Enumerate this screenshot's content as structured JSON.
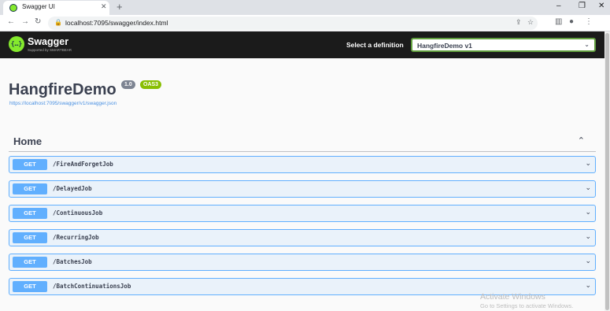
{
  "browser": {
    "tab_title": "Swagger UI",
    "tab_close": "✕",
    "new_tab": "+",
    "window_controls": [
      "–",
      "❐",
      "✕"
    ],
    "url": "localhost:7095/swagger/index.html",
    "nav_icons": [
      "arrow-left-icon",
      "arrow-right-icon",
      "reload-icon"
    ]
  },
  "topbar": {
    "logo_glyph": "{…}",
    "logo_text": "Swagger",
    "logo_sub": "Supported by SMARTBEAR",
    "definition_label": "Select a definition",
    "definition_value": "HangfireDemo v1"
  },
  "info": {
    "title": "HangfireDemo",
    "version": "1.0",
    "oas": "OAS3",
    "spec_url": "https://localhost:7095/swagger/v1/swagger.json"
  },
  "tag": {
    "name": "Home"
  },
  "operations": [
    {
      "method": "GET",
      "path": "/FireAndForgetJob"
    },
    {
      "method": "GET",
      "path": "/DelayedJob"
    },
    {
      "method": "GET",
      "path": "/ContinuousJob"
    },
    {
      "method": "GET",
      "path": "/RecurringJob"
    },
    {
      "method": "GET",
      "path": "/BatchesJob"
    },
    {
      "method": "GET",
      "path": "/BatchContinuationsJob"
    }
  ],
  "watermark": {
    "line1": "Activate Windows",
    "line2": "Go to Settings to activate Windows."
  },
  "colors": {
    "get_accent": "#61affe",
    "swagger_green": "#85ea2d",
    "topbar_bg": "#1b1b1b"
  }
}
